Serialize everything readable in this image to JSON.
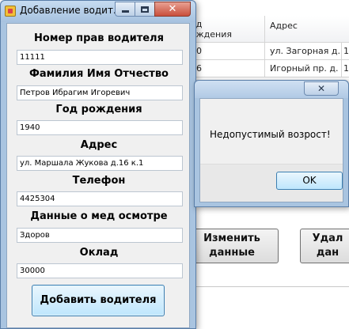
{
  "form": {
    "title": "Добавление водит...",
    "fields": [
      {
        "label": "Номер прав водителя",
        "value": "11111"
      },
      {
        "label": "Фамилия Имя Отчество",
        "value": "Петров Ибрагим Игоревич"
      },
      {
        "label": "Год рождения",
        "value": "1940"
      },
      {
        "label": "Адрес",
        "value": "ул. Маршала Жукова д.16 к.1"
      },
      {
        "label": "Телефон",
        "value": "4425304"
      },
      {
        "label": "Данные о мед осмотре",
        "value": "Здоров"
      },
      {
        "label": "Оклад",
        "value": "30000"
      }
    ],
    "add_button": "Добавить водителя"
  },
  "background": {
    "grid": {
      "columns": [
        "од\nождения",
        "Адрес"
      ],
      "rows": [
        [
          "80",
          "ул. Загорная д. 3",
          "1"
        ],
        [
          "76",
          "Игорный пр. д. 5",
          "1"
        ]
      ]
    },
    "buttons": {
      "edit": "Изменить\nданные",
      "delete": "Удал\nдан"
    }
  },
  "message": {
    "text": "Недопустимый возрост!",
    "ok_button": "OK"
  },
  "colors": {
    "title_bar": "#b1cae5",
    "window_body": "#f0f0f0",
    "button_blue": "#bee6fd",
    "close_red": "#c94f3c"
  },
  "icons": [
    "app-icon",
    "minimize-icon",
    "maximize-icon",
    "close-icon"
  ]
}
